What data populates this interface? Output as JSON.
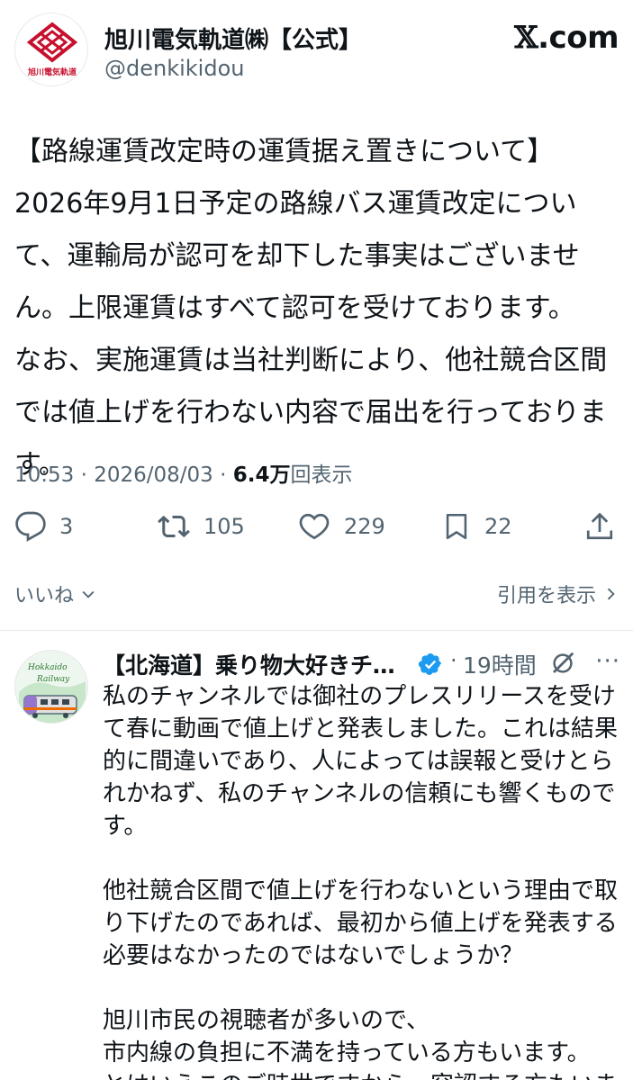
{
  "tweet": {
    "avatar_logo_text": "旭川電気軌道",
    "author_name": "旭川電気軌道㈱【公式】",
    "author_handle": "@denkikidou",
    "source_brand_x": "𝕏",
    "source_brand_suffix": ".com",
    "text": "【路線運賃改定時の運賃据え置きについて】\n2026年9月1日予定の路線バス運賃改定について、運輸局が認可を却下した事実はございません。上限運賃はすべて認可を受けております。\nなお、実施運賃は当社判断により、他社競合区間では値上げを行わない内容で届出を行っております。",
    "time": "10:53",
    "date": "2026/08/03",
    "separator": " · ",
    "views_count": "6.4万",
    "views_label": "回表示",
    "replies": "3",
    "retweets": "105",
    "likes": "229",
    "bookmarks": "22",
    "likes_link": "いいね",
    "quotes_link": "引用を表示"
  },
  "reply": {
    "avatar_text_1": "Hokkaido",
    "avatar_text_2": "Railway",
    "author_name": "【北海道】乗り物大好きチャ...",
    "dot": "·",
    "time": "19時間",
    "more": "···",
    "text": "私のチャンネルでは御社のプレスリリースを受けて春に動画で値上げと発表しました。これは結果的に間違いであり、人によっては誤報と受けとられかねず、私のチャンネルの信頼にも響くものです。\n\n他社競合区間で値上げを行わないという理由で取り下げたのであれば、最初から値上げを発表する必要はなかったのではないでしょうか？\n\n旭川市民の視聴者が多いので、\n市内線の負担に不満を持っている方もいます。\nとはいえこのご時世ですから、容認する方もいます。"
  },
  "colors": {
    "brand_red": "#c8102e",
    "muted": "#536471",
    "text": "#0f1419",
    "verified_blue": "#1d9bf0"
  }
}
